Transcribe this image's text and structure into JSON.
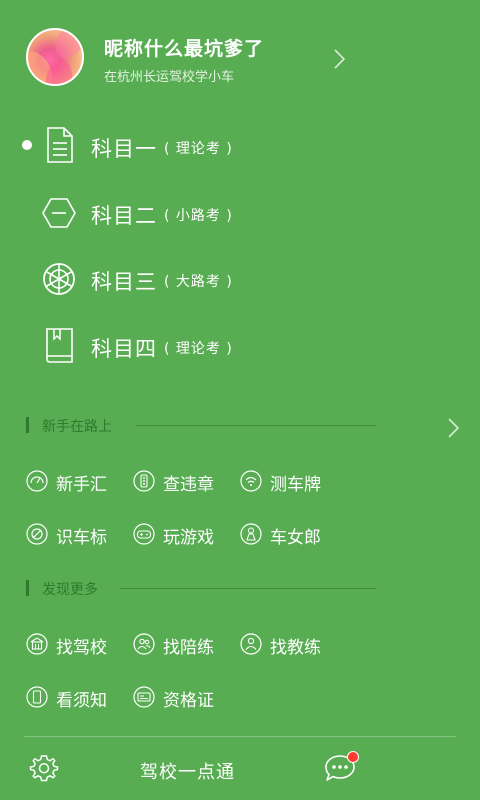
{
  "profile": {
    "nickname": "昵称什么最坑爹了",
    "subtitle": "在杭州长运驾校学小车"
  },
  "subjects": [
    {
      "name": "科目一",
      "tag": "( 理论考 )",
      "icon": "document-icon",
      "selected": true
    },
    {
      "name": "科目二",
      "tag": "( 小路考 )",
      "icon": "hexagon-icon",
      "selected": false
    },
    {
      "name": "科目三",
      "tag": "( 大路考 )",
      "icon": "steering-wheel-icon",
      "selected": false
    },
    {
      "name": "科目四",
      "tag": "( 理论考 )",
      "icon": "book-icon",
      "selected": false
    }
  ],
  "sections": {
    "newbie": {
      "title": "新手在路上",
      "items": [
        {
          "label": "新手汇",
          "icon": "dashboard-icon"
        },
        {
          "label": "查违章",
          "icon": "traffic-light-icon"
        },
        {
          "label": "测车牌",
          "icon": "signal-icon"
        },
        {
          "label": "识车标",
          "icon": "car-logo-icon"
        },
        {
          "label": "玩游戏",
          "icon": "gamepad-icon"
        },
        {
          "label": "车女郎",
          "icon": "person-icon"
        }
      ]
    },
    "discover": {
      "title": "发现更多",
      "items": [
        {
          "label": "找驾校",
          "icon": "school-icon"
        },
        {
          "label": "找陪练",
          "icon": "people-icon"
        },
        {
          "label": "找教练",
          "icon": "user-icon"
        },
        {
          "label": "看须知",
          "icon": "phone-icon"
        },
        {
          "label": "资格证",
          "icon": "certificate-icon"
        }
      ]
    }
  },
  "bottom": {
    "app_title": "驾校一点通",
    "has_notification": true
  },
  "colors": {
    "background": "#58ad53",
    "section_title": "#2f7a2c",
    "badge": "#ff3b30"
  }
}
